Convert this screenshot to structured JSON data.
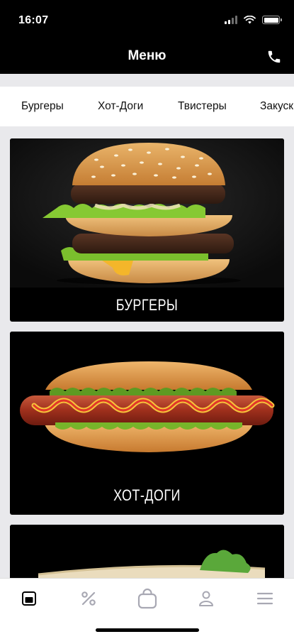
{
  "status": {
    "time": "16:07"
  },
  "header": {
    "title": "Меню",
    "phone_icon": "phone-icon"
  },
  "tabs": [
    {
      "label": "Бургеры"
    },
    {
      "label": "Хот-Доги"
    },
    {
      "label": "Твистеры"
    },
    {
      "label": "Закуски"
    }
  ],
  "cards": [
    {
      "title": "БУРГЕРЫ",
      "image": "burger-photo"
    },
    {
      "title": "ХОТ-ДОГИ",
      "image": "hotdog-photo"
    },
    {
      "title": "",
      "image": "twister-photo"
    }
  ],
  "bottom_nav": [
    {
      "icon": "menu-card-icon",
      "active": true
    },
    {
      "icon": "percent-icon",
      "active": false
    },
    {
      "icon": "bag-icon",
      "active": false
    },
    {
      "icon": "profile-icon",
      "active": false
    },
    {
      "icon": "hamburger-menu-icon",
      "active": false
    }
  ],
  "colors": {
    "bar_bg": "#000000",
    "tab_bg": "#ffffff",
    "page_bg": "#e9e9ec",
    "inactive_icon": "#a8a8b3"
  }
}
